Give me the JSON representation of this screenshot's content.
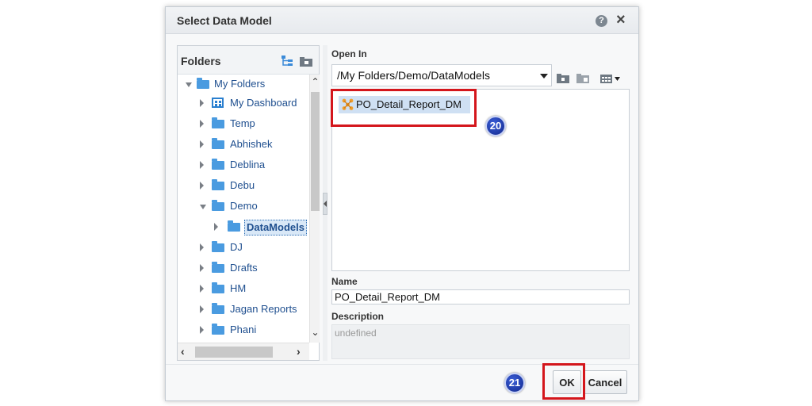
{
  "dialog": {
    "title": "Select Data Model",
    "help_icon": "help-icon",
    "close_icon": "close-icon",
    "help_symbol": "?",
    "close_symbol": "×"
  },
  "folders": {
    "title": "Folders",
    "items": [
      {
        "label": "My Folders",
        "icon": "folder-icon",
        "expanded": true,
        "level": 0
      },
      {
        "label": "My Dashboard",
        "icon": "dashboard-icon",
        "expanded": false,
        "level": 1
      },
      {
        "label": "Temp",
        "icon": "folder-icon",
        "expanded": false,
        "level": 1
      },
      {
        "label": "Abhishek",
        "icon": "folder-icon",
        "expanded": false,
        "level": 1
      },
      {
        "label": "Deblina",
        "icon": "folder-icon",
        "expanded": false,
        "level": 1
      },
      {
        "label": "Debu",
        "icon": "folder-icon",
        "expanded": false,
        "level": 1
      },
      {
        "label": "Demo",
        "icon": "folder-icon",
        "expanded": true,
        "level": 1
      },
      {
        "label": "DataModels",
        "icon": "folder-icon",
        "expanded": false,
        "level": 2,
        "selected": true
      },
      {
        "label": "DJ",
        "icon": "folder-icon",
        "expanded": false,
        "level": 1
      },
      {
        "label": "Drafts",
        "icon": "folder-icon",
        "expanded": false,
        "level": 1
      },
      {
        "label": "HM",
        "icon": "folder-icon",
        "expanded": false,
        "level": 1
      },
      {
        "label": "Jagan Reports",
        "icon": "folder-icon",
        "expanded": false,
        "level": 1
      },
      {
        "label": "Phani",
        "icon": "folder-icon",
        "expanded": false,
        "level": 1
      }
    ]
  },
  "open_in": {
    "label": "Open In",
    "path": "/My Folders/Demo/DataModels",
    "items": [
      {
        "label": "PO_Detail_Report_DM",
        "icon": "data-model-icon",
        "selected": true
      }
    ]
  },
  "name": {
    "label": "Name",
    "value": "PO_Detail_Report_DM"
  },
  "description": {
    "label": "Description",
    "value": "undefined"
  },
  "buttons": {
    "ok": "OK",
    "cancel": "Cancel"
  },
  "annotations": {
    "step_20": "20",
    "step_21": "21",
    "highlight_color": "#d4161c",
    "badge_color": "#1a35a8"
  }
}
